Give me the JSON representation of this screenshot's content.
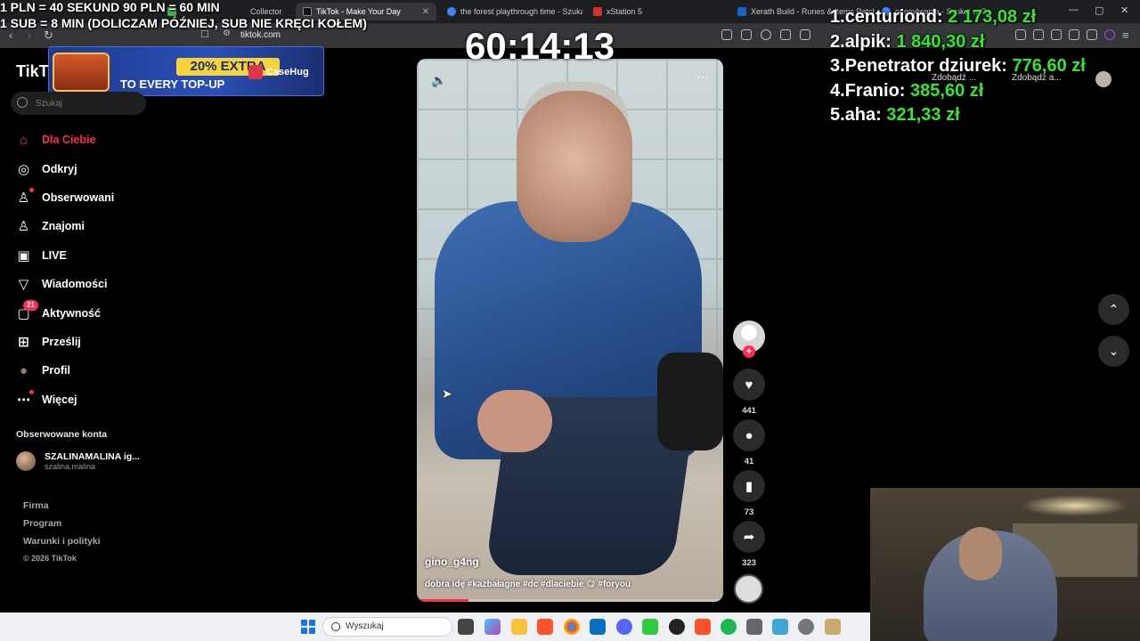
{
  "overlay": {
    "line1": "1 PLN = 40 SEKUND 90 PLN = 60 MIN",
    "line2": "1 SUB = 8 MIN (DOLICZAM PÓŹNIEJ, SUB NIE KRĘCI KOŁEM)",
    "timer": "60:14:13"
  },
  "leaderboard": [
    {
      "rank": "1.",
      "name": "centuriond:",
      "amount": "2 173,08 zł"
    },
    {
      "rank": "2.",
      "name": "alpik:",
      "amount": "1 840,30 zł"
    },
    {
      "rank": "3.",
      "name": "Penetrator dziurek:",
      "amount": "776,60 zł"
    },
    {
      "rank": "4.",
      "name": "Franio:",
      "amount": "385,60 zł"
    },
    {
      "rank": "5.",
      "name": "aha:",
      "amount": "321,33 zł"
    }
  ],
  "browser": {
    "tabs": [
      {
        "label": "Collector",
        "color": "#4caf50"
      },
      {
        "label": "TikTok - Make Your Day",
        "color": "#111111"
      },
      {
        "label": "the forest playthrough time - Szukaj",
        "color": "#4285f4"
      },
      {
        "label": "xStation 5",
        "color": "#d32f2f"
      },
      {
        "label": "Xerath Build - Runes & Items Patch",
        "color": "#1565c0"
      },
      {
        "label": "pensylwania - Szukaj w Google",
        "color": "#4285f4"
      }
    ],
    "url": "tiktok.com"
  },
  "promo": {
    "headline": "20% EXTRA",
    "subline": "TO EVERY TOP-UP",
    "brand": "CaseHug"
  },
  "sidebar": {
    "logo": "TikTok",
    "search_placeholder": "Szukaj",
    "items": [
      {
        "label": "Dla Ciebie",
        "icon": "home-icon",
        "glyph": "⌂"
      },
      {
        "label": "Odkryj",
        "icon": "compass-icon",
        "glyph": "◎"
      },
      {
        "label": "Obserwowani",
        "icon": "following-icon",
        "glyph": "♙"
      },
      {
        "label": "Znajomi",
        "icon": "friends-icon",
        "glyph": "♙"
      },
      {
        "label": "LIVE",
        "icon": "live-icon",
        "glyph": "▣"
      },
      {
        "label": "Wiadomości",
        "icon": "messages-icon",
        "glyph": "▽"
      },
      {
        "label": "Aktywność",
        "icon": "activity-icon",
        "glyph": "▢"
      },
      {
        "label": "Prześlij",
        "icon": "upload-icon",
        "glyph": "⊞"
      },
      {
        "label": "Profil",
        "icon": "profile-icon",
        "glyph": "●"
      },
      {
        "label": "Więcej",
        "icon": "more-icon",
        "glyph": "⋯"
      }
    ],
    "activity_badge": "21",
    "followed_heading": "Obserwowane konta",
    "followed_account": {
      "name": "SZALINAMALINA ig...",
      "handle": "szalina.malina"
    },
    "footer": [
      "Firma",
      "Program",
      "Warunki i polityki"
    ],
    "copyright": "© 2026 TikTok"
  },
  "video": {
    "author": "gino_g4ng",
    "caption": "dobra idę #kazbałagne #dc #dlaciebie 😋 #foryou",
    "progress": 0.17
  },
  "actions": {
    "likes": "441",
    "comments": "41",
    "saves": "73",
    "shares": "323"
  },
  "top_right": {
    "chip1": "Zdobądź ...",
    "chip2": "Zdobądź a..."
  },
  "taskbar": {
    "search_label": "Wyszukaj"
  }
}
